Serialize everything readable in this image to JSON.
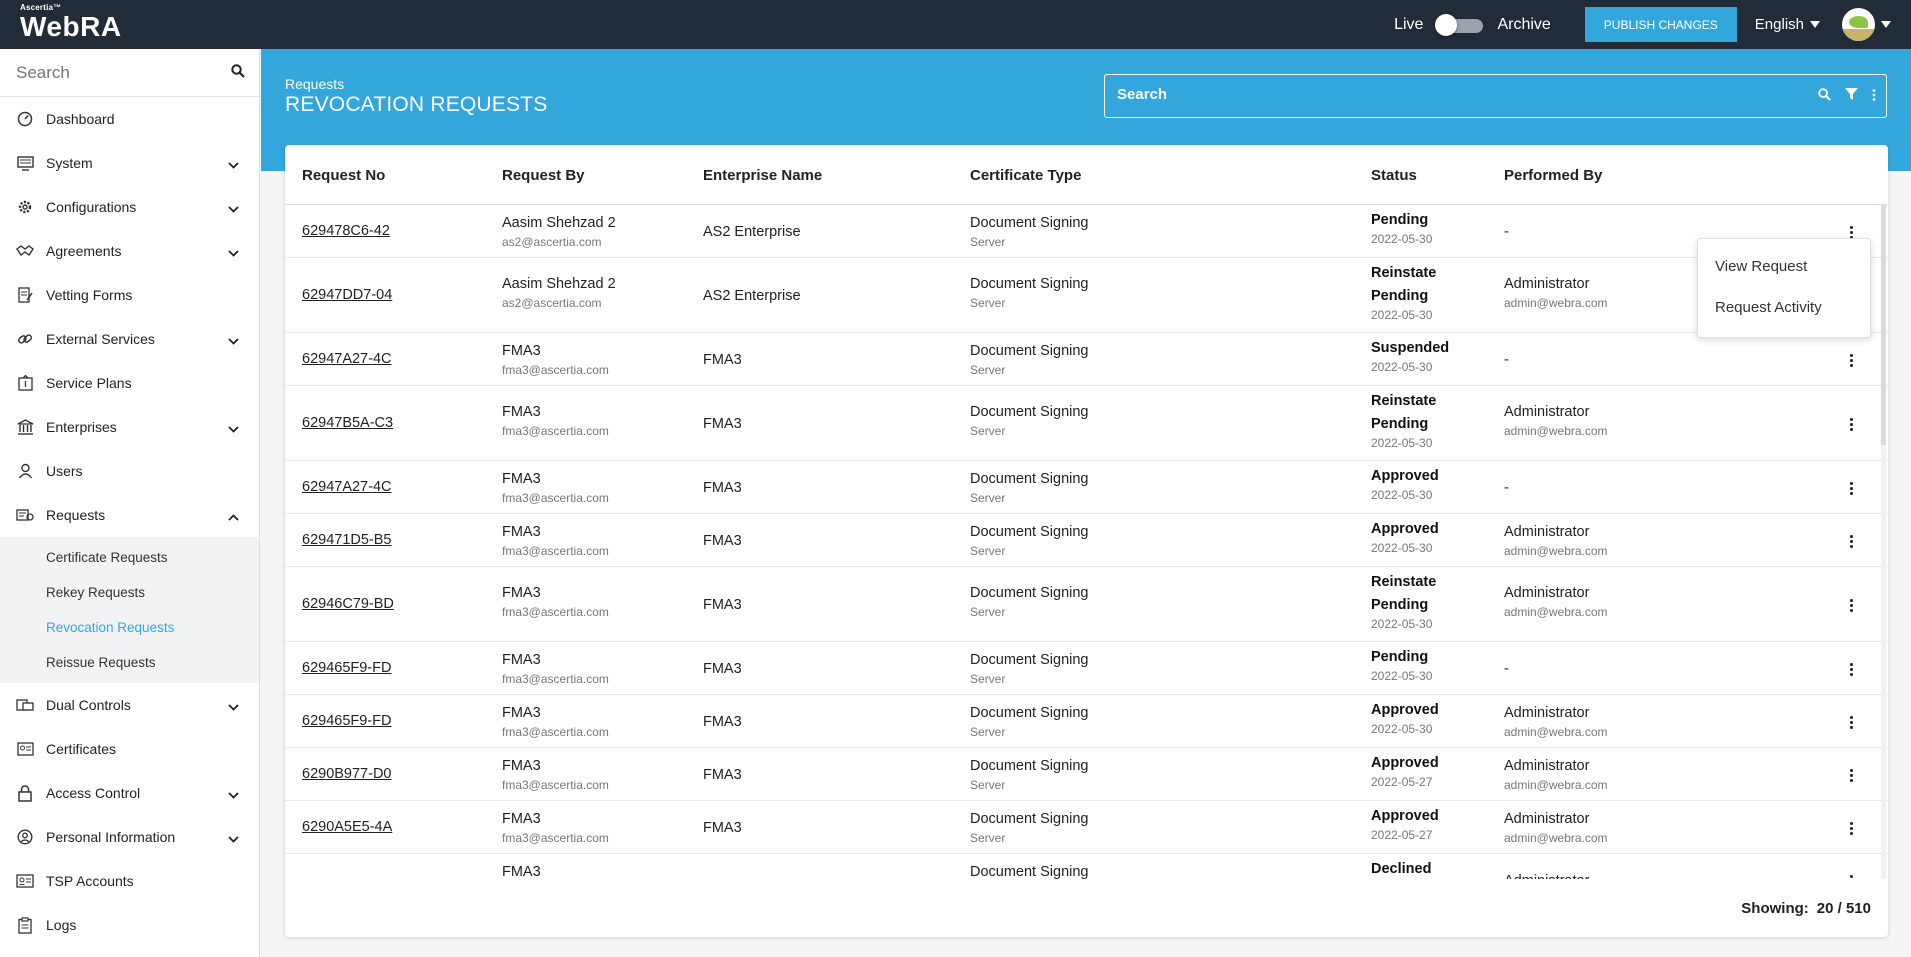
{
  "topbar": {
    "brand_small": "Ascertia™",
    "brand_name": "WebRA",
    "live_label": "Live",
    "archive_label": "Archive",
    "publish_label": "PUBLISH CHANGES",
    "language": "English"
  },
  "sidebar": {
    "search_placeholder": "Search",
    "items": [
      {
        "label": "Dashboard",
        "icon": "gauge-icon",
        "chevron": ""
      },
      {
        "label": "System",
        "icon": "monitor-icon",
        "chevron": "down"
      },
      {
        "label": "Configurations",
        "icon": "gear-icon",
        "chevron": "down"
      },
      {
        "label": "Agreements",
        "icon": "handshake-icon",
        "chevron": "down"
      },
      {
        "label": "Vetting Forms",
        "icon": "form-icon",
        "chevron": ""
      },
      {
        "label": "External Services",
        "icon": "link-icon",
        "chevron": "down"
      },
      {
        "label": "Service Plans",
        "icon": "plan-icon",
        "chevron": ""
      },
      {
        "label": "Enterprises",
        "icon": "bank-icon",
        "chevron": "down"
      },
      {
        "label": "Users",
        "icon": "user-icon",
        "chevron": ""
      },
      {
        "label": "Requests",
        "icon": "requests-icon",
        "chevron": "up"
      },
      {
        "label": "Dual Controls",
        "icon": "dual-control-icon",
        "chevron": "down"
      },
      {
        "label": "Certificates",
        "icon": "certificate-icon",
        "chevron": ""
      },
      {
        "label": "Access Control",
        "icon": "lock-icon",
        "chevron": "down"
      },
      {
        "label": "Personal Information",
        "icon": "person-circle-icon",
        "chevron": "down"
      },
      {
        "label": "TSP Accounts",
        "icon": "id-card-icon",
        "chevron": ""
      },
      {
        "label": "Logs",
        "icon": "clipboard-icon",
        "chevron": ""
      }
    ],
    "requests_sub": [
      {
        "label": "Certificate Requests",
        "active": false
      },
      {
        "label": "Rekey Requests",
        "active": false
      },
      {
        "label": "Revocation Requests",
        "active": true
      },
      {
        "label": "Reissue Requests",
        "active": false
      }
    ]
  },
  "header": {
    "breadcrumb": "Requests",
    "title": "REVOCATION REQUESTS",
    "search_placeholder": "Search"
  },
  "table": {
    "columns": [
      "Request No",
      "Request By",
      "Enterprise Name",
      "Certificate Type",
      "Status",
      "Performed By"
    ],
    "rows": [
      {
        "no": "629478C6-42",
        "by_name": "Aasim Shehzad 2",
        "by_email": "as2@ascertia.com",
        "enterprise": "AS2 Enterprise",
        "cert_type": "Document Signing",
        "cert_sub": "Server",
        "status": [
          "Pending"
        ],
        "date": "2022-05-30",
        "perf_name": "-",
        "perf_email": ""
      },
      {
        "no": "62947DD7-04",
        "by_name": "Aasim Shehzad 2",
        "by_email": "as2@ascertia.com",
        "enterprise": "AS2 Enterprise",
        "cert_type": "Document Signing",
        "cert_sub": "Server",
        "status": [
          "Reinstate",
          "Pending"
        ],
        "date": "2022-05-30",
        "perf_name": "Administrator",
        "perf_email": "admin@webra.com"
      },
      {
        "no": "62947A27-4C",
        "by_name": "FMA3",
        "by_email": "fma3@ascertia.com",
        "enterprise": "FMA3",
        "cert_type": "Document Signing",
        "cert_sub": "Server",
        "status": [
          "Suspended"
        ],
        "date": "2022-05-30",
        "perf_name": "-",
        "perf_email": ""
      },
      {
        "no": "62947B5A-C3",
        "by_name": "FMA3",
        "by_email": "fma3@ascertia.com",
        "enterprise": "FMA3",
        "cert_type": "Document Signing",
        "cert_sub": "Server",
        "status": [
          "Reinstate",
          "Pending"
        ],
        "date": "2022-05-30",
        "perf_name": "Administrator",
        "perf_email": "admin@webra.com"
      },
      {
        "no": "62947A27-4C",
        "by_name": "FMA3",
        "by_email": "fma3@ascertia.com",
        "enterprise": "FMA3",
        "cert_type": "Document Signing",
        "cert_sub": "Server",
        "status": [
          "Approved"
        ],
        "date": "2022-05-30",
        "perf_name": "-",
        "perf_email": ""
      },
      {
        "no": "629471D5-B5",
        "by_name": "FMA3",
        "by_email": "fma3@ascertia.com",
        "enterprise": "FMA3",
        "cert_type": "Document Signing",
        "cert_sub": "Server",
        "status": [
          "Approved"
        ],
        "date": "2022-05-30",
        "perf_name": "Administrator",
        "perf_email": "admin@webra.com"
      },
      {
        "no": "62946C79-BD",
        "by_name": "FMA3",
        "by_email": "fma3@ascertia.com",
        "enterprise": "FMA3",
        "cert_type": "Document Signing",
        "cert_sub": "Server",
        "status": [
          "Reinstate",
          "Pending"
        ],
        "date": "2022-05-30",
        "perf_name": "Administrator",
        "perf_email": "admin@webra.com"
      },
      {
        "no": "629465F9-FD",
        "by_name": "FMA3",
        "by_email": "fma3@ascertia.com",
        "enterprise": "FMA3",
        "cert_type": "Document Signing",
        "cert_sub": "Server",
        "status": [
          "Pending"
        ],
        "date": "2022-05-30",
        "perf_name": "-",
        "perf_email": ""
      },
      {
        "no": "629465F9-FD",
        "by_name": "FMA3",
        "by_email": "fma3@ascertia.com",
        "enterprise": "FMA3",
        "cert_type": "Document Signing",
        "cert_sub": "Server",
        "status": [
          "Approved"
        ],
        "date": "2022-05-30",
        "perf_name": "Administrator",
        "perf_email": "admin@webra.com"
      },
      {
        "no": "6290B977-D0",
        "by_name": "FMA3",
        "by_email": "fma3@ascertia.com",
        "enterprise": "FMA3",
        "cert_type": "Document Signing",
        "cert_sub": "Server",
        "status": [
          "Approved"
        ],
        "date": "2022-05-27",
        "perf_name": "Administrator",
        "perf_email": "admin@webra.com"
      },
      {
        "no": "6290A5E5-4A",
        "by_name": "FMA3",
        "by_email": "fma3@ascertia.com",
        "enterprise": "FMA3",
        "cert_type": "Document Signing",
        "cert_sub": "Server",
        "status": [
          "Approved"
        ],
        "date": "2022-05-27",
        "perf_name": "Administrator",
        "perf_email": "admin@webra.com"
      },
      {
        "no": "",
        "by_name": "FMA3",
        "by_email": "",
        "enterprise": "",
        "cert_type": "Document Signing",
        "cert_sub": "",
        "status": [
          "Declined"
        ],
        "date": "",
        "perf_name": "Administrator",
        "perf_email": ""
      }
    ],
    "showing_label": "Showing:",
    "showing_count": "20 / 510"
  },
  "context_menu": {
    "items": [
      "View Request",
      "Request Activity"
    ]
  }
}
